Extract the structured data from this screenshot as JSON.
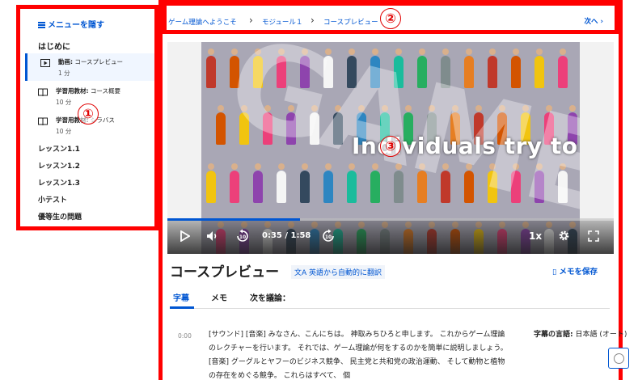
{
  "sidebar": {
    "menu_toggle": "メニューを隠す",
    "section_heading": "はじめに",
    "items": [
      {
        "kind": "動画:",
        "title": "コースプレビュー",
        "duration": "1 分",
        "icon": "video-icon",
        "active": true
      },
      {
        "kind": "学習用教材:",
        "title": "コース概要",
        "duration": "10 分",
        "icon": "book-icon",
        "active": false
      },
      {
        "kind": "学習用教材:",
        "title": "シラバス",
        "duration": "10 分",
        "icon": "book-icon",
        "active": false
      }
    ],
    "lessons": [
      "レッスン1.1",
      "レッスン1.2",
      "レッスン1.3",
      "小テスト",
      "優等生の問題"
    ]
  },
  "callouts": {
    "one": "①",
    "two": "②",
    "three": "③"
  },
  "breadcrumb": {
    "items": [
      "ゲーム理論へようこそ",
      "モジュール１",
      "コースプレビュー"
    ],
    "separator": "›",
    "next_label": "次へ",
    "next_icon": "chevron-right-icon"
  },
  "video": {
    "watermark": "GAMES",
    "caption_overlay": "Individuals try to c",
    "time": "0:35 / 1:58",
    "progress": 0.297,
    "speed": "1x",
    "controls": [
      "play-icon",
      "volume-icon",
      "rewind-10-icon",
      "forward-10-icon",
      "gear-icon",
      "fullscreen-icon"
    ],
    "rewind_label": "10",
    "forward_label": "10"
  },
  "title": {
    "text": "コースプレビュー",
    "translate": "英語から自動的に翻訳",
    "save_note": "メモを保存"
  },
  "tabs": [
    "字幕",
    "メモ",
    "次を議論："
  ],
  "transcript": {
    "timestamp": "0:00",
    "text": "[サウンド] [音楽] みなさん、こんにちは。 神取みちひろと申します。 これからゲーム理論のレクチャーを行います。 それでは、ゲーム理論が何をするのかを簡単に説明しましょう。 [音楽] グーグルとヤフーのビジネス競争、 民主党と共和党の政治運動、 そして動物と植物の存在をめぐる競争。 これらはすべて、 個"
  },
  "language": {
    "label": "字幕の言語:",
    "value": "日本語 (オート)"
  },
  "colors": {
    "accent": "#0056d2",
    "annotation": "#ff0000"
  }
}
